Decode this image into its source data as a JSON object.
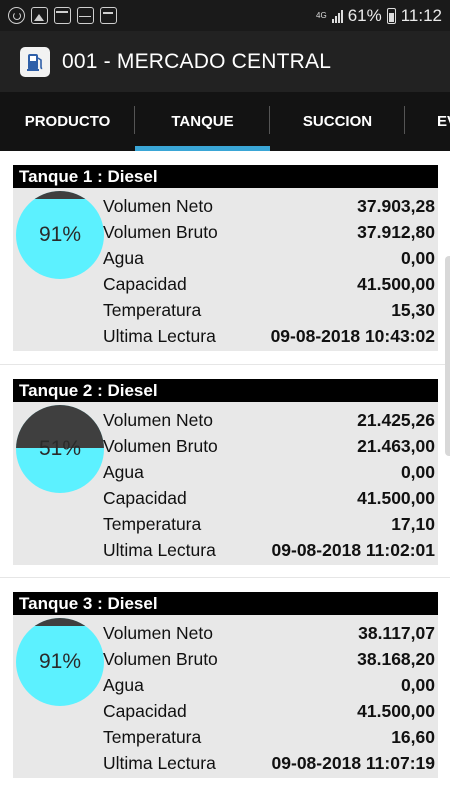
{
  "status_bar": {
    "network": "4G",
    "battery": "61%",
    "time": "11:12",
    "left_icons": [
      "whatsapp-icon",
      "gallery-icon",
      "calendar-icon",
      "outlook-icon",
      "card-icon"
    ]
  },
  "app_bar": {
    "title": "001 - MERCADO CENTRAL",
    "icon": "fuel-pump-icon"
  },
  "tabs": [
    {
      "label": "PRODUCTO",
      "active": false
    },
    {
      "label": "TANQUE",
      "active": true
    },
    {
      "label": "SUCCION",
      "active": false
    },
    {
      "label": "EV",
      "active": false
    }
  ],
  "colors": {
    "gauge_fill": "#5cf1ff",
    "gauge_empty": "#3f3f3f",
    "tab_indicator": "#3aa6d6",
    "header_bg": "#000000",
    "body_bg": "#e8e8e8"
  },
  "tanks": [
    {
      "title": "Tanque 1 : Diesel",
      "fill_percent": 91,
      "fill_label": "91%",
      "rows": [
        {
          "label": "Volumen Neto",
          "value": "37.903,28"
        },
        {
          "label": "Volumen Bruto",
          "value": "37.912,80"
        },
        {
          "label": "Agua",
          "value": "0,00"
        },
        {
          "label": "Capacidad",
          "value": "41.500,00"
        },
        {
          "label": "Temperatura",
          "value": "15,30"
        },
        {
          "label": "Ultima Lectura",
          "value": "09-08-2018 10:43:02"
        }
      ]
    },
    {
      "title": "Tanque 2 : Diesel",
      "fill_percent": 51,
      "fill_label": "51%",
      "rows": [
        {
          "label": "Volumen Neto",
          "value": "21.425,26"
        },
        {
          "label": "Volumen Bruto",
          "value": "21.463,00"
        },
        {
          "label": "Agua",
          "value": "0,00"
        },
        {
          "label": "Capacidad",
          "value": "41.500,00"
        },
        {
          "label": "Temperatura",
          "value": "17,10"
        },
        {
          "label": "Ultima Lectura",
          "value": "09-08-2018 11:02:01"
        }
      ]
    },
    {
      "title": "Tanque 3 : Diesel",
      "fill_percent": 91,
      "fill_label": "91%",
      "rows": [
        {
          "label": "Volumen Neto",
          "value": "38.117,07"
        },
        {
          "label": "Volumen Bruto",
          "value": "38.168,20"
        },
        {
          "label": "Agua",
          "value": "0,00"
        },
        {
          "label": "Capacidad",
          "value": "41.500,00"
        },
        {
          "label": "Temperatura",
          "value": "16,60"
        },
        {
          "label": "Ultima Lectura",
          "value": "09-08-2018 11:07:19"
        }
      ]
    }
  ]
}
